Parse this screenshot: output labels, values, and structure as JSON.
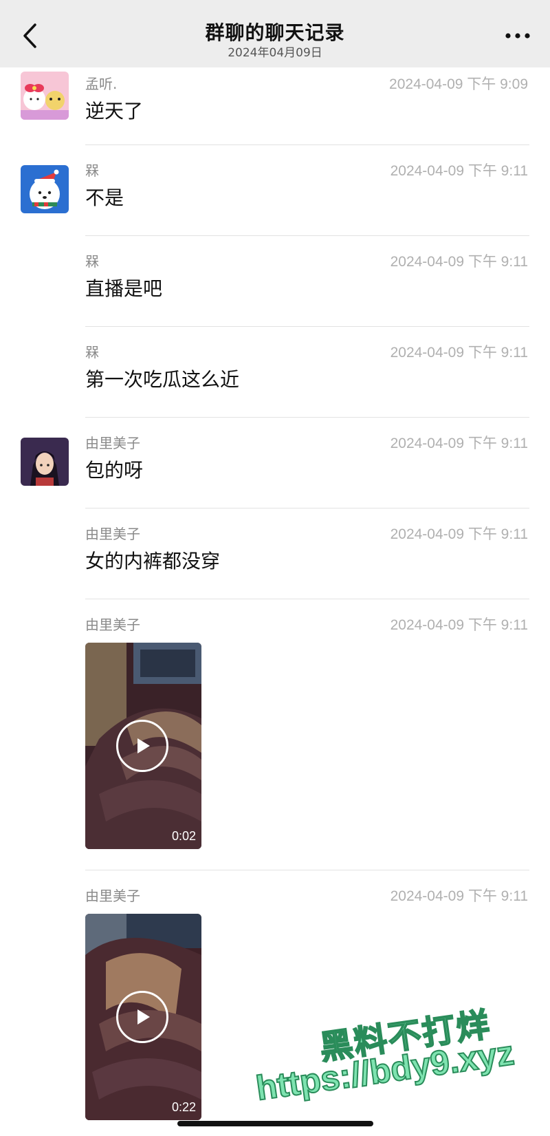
{
  "header": {
    "title": "群聊的聊天记录",
    "date": "2024年04月09日",
    "back_icon": "chevron-left-icon",
    "more_icon": "more-dots-icon"
  },
  "messages": [
    {
      "sender": "孟听.",
      "time": "2024-04-09 下午 9:09",
      "text": "逆天了",
      "avatar": "hello-kitty-avatar"
    },
    {
      "sender": "槑",
      "time": "2024-04-09 下午 9:11",
      "text": "不是",
      "avatar": "white-dog-santa-avatar"
    },
    {
      "sender": "槑",
      "time": "2024-04-09 下午 9:11",
      "text": "直播是吧"
    },
    {
      "sender": "槑",
      "time": "2024-04-09 下午 9:11",
      "text": "第一次吃瓜这么近"
    },
    {
      "sender": "由里美子",
      "time": "2024-04-09 下午 9:11",
      "text": "包的呀",
      "avatar": "anime-girl-avatar"
    },
    {
      "sender": "由里美子",
      "time": "2024-04-09 下午 9:11",
      "text": "女的内裤都没穿"
    },
    {
      "sender": "由里美子",
      "time": "2024-04-09 下午 9:11",
      "video_duration": "0:02"
    },
    {
      "sender": "由里美子",
      "time": "2024-04-09 下午 9:11",
      "video_duration": "0:22"
    }
  ],
  "watermark": {
    "line1": "黑料不打烊",
    "line2": "https://bdy9.xyz"
  },
  "colors": {
    "header_bg": "#ededed",
    "watermark_fill": "#7ee3b0"
  }
}
